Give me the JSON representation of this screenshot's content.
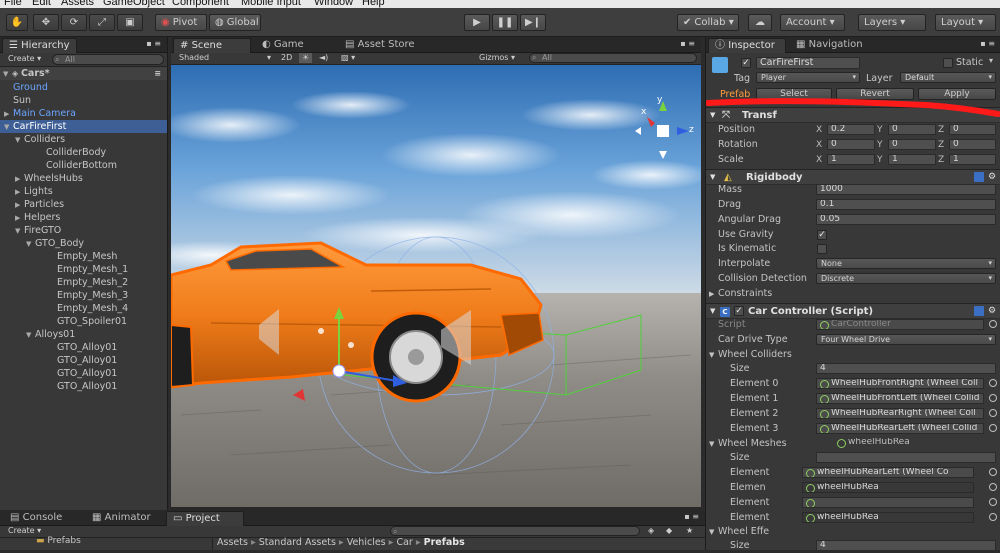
{
  "menu": [
    "File",
    "Edit",
    "Assets",
    "GameObject",
    "Component",
    "Mobile Input",
    "Window",
    "Help"
  ],
  "toolbar": {
    "pivot": "Pivot",
    "global": "Global",
    "collab": "Collab",
    "account": "Account",
    "layers": "Layers",
    "layout": "Layout"
  },
  "hierarchy": {
    "tab": "Hierarchy",
    "create": "Create",
    "search_placeholder": "All",
    "scene_name": "Cars*",
    "items": [
      {
        "label": "Ground",
        "indent": 1,
        "style": "blue",
        "arrow": ""
      },
      {
        "label": "Sun",
        "indent": 1,
        "style": "",
        "arrow": ""
      },
      {
        "label": "Main Camera",
        "indent": 1,
        "style": "blue",
        "arrow": "▶"
      },
      {
        "label": "CarFireFirst",
        "indent": 1,
        "style": "sel",
        "arrow": "▼"
      },
      {
        "label": "Colliders",
        "indent": 2,
        "style": "",
        "arrow": "▼"
      },
      {
        "label": "ColliderBody",
        "indent": 4,
        "style": "",
        "arrow": ""
      },
      {
        "label": "ColliderBottom",
        "indent": 4,
        "style": "",
        "arrow": ""
      },
      {
        "label": "WheelsHubs",
        "indent": 2,
        "style": "",
        "arrow": "▶"
      },
      {
        "label": "Lights",
        "indent": 2,
        "style": "",
        "arrow": "▶"
      },
      {
        "label": "Particles",
        "indent": 2,
        "style": "",
        "arrow": "▶"
      },
      {
        "label": "Helpers",
        "indent": 2,
        "style": "",
        "arrow": "▶"
      },
      {
        "label": "FireGTO",
        "indent": 2,
        "style": "",
        "arrow": "▼"
      },
      {
        "label": "GTO_Body",
        "indent": 3,
        "style": "",
        "arrow": "▼"
      },
      {
        "label": "Empty_Mesh",
        "indent": 5,
        "style": "",
        "arrow": ""
      },
      {
        "label": "Empty_Mesh_1",
        "indent": 5,
        "style": "",
        "arrow": ""
      },
      {
        "label": "Empty_Mesh_2",
        "indent": 5,
        "style": "",
        "arrow": ""
      },
      {
        "label": "Empty_Mesh_3",
        "indent": 5,
        "style": "",
        "arrow": ""
      },
      {
        "label": "Empty_Mesh_4",
        "indent": 5,
        "style": "",
        "arrow": ""
      },
      {
        "label": "GTO_Spoiler01",
        "indent": 5,
        "style": "",
        "arrow": ""
      },
      {
        "label": "Alloys01",
        "indent": 3,
        "style": "",
        "arrow": "▼"
      },
      {
        "label": "GTO_Alloy01",
        "indent": 5,
        "style": "",
        "arrow": ""
      },
      {
        "label": "GTO_Alloy01",
        "indent": 5,
        "style": "",
        "arrow": ""
      },
      {
        "label": "GTO_Alloy01",
        "indent": 5,
        "style": "",
        "arrow": ""
      },
      {
        "label": "GTO_Alloy01",
        "indent": 5,
        "style": "",
        "arrow": ""
      }
    ]
  },
  "scene": {
    "tabs": [
      "Scene",
      "Game",
      "Asset Store"
    ],
    "shaded": "Shaded",
    "mode_2d": "2D",
    "gizmos": "Gizmos",
    "search_placeholder": "All",
    "axis_y": "y",
    "axis_x": "x",
    "axis_z": "z"
  },
  "inspector": {
    "tabs": [
      "Inspector",
      "Navigation"
    ],
    "object_name": "CarFireFirst",
    "static_label": "Static",
    "tag_label": "Tag",
    "tag_value": "Player",
    "layer_label": "Layer",
    "layer_value": "Default",
    "prefab_label": "Prefab",
    "prefab_select": "Select",
    "prefab_revert": "Revert",
    "prefab_apply": "Apply",
    "transform": {
      "title": "Transf",
      "rows": [
        {
          "label": "Position",
          "x": "0.2",
          "y": "0",
          "z": "0"
        },
        {
          "label": "Rotation",
          "x": "0",
          "y": "0",
          "z": "0"
        },
        {
          "label": "Scale",
          "x": "1",
          "y": "1",
          "z": "1"
        }
      ]
    },
    "rigidbody": {
      "title": "Rigidbody",
      "mass_label": "Mass",
      "mass": "1000",
      "drag_label": "Drag",
      "drag": "0.1",
      "angular_drag_label": "Angular Drag",
      "angular_drag": "0.05",
      "use_gravity_label": "Use Gravity",
      "is_kinematic_label": "Is Kinematic",
      "interpolate_label": "Interpolate",
      "interpolate": "None",
      "collision_label": "Collision Detection",
      "collision": "Discrete",
      "constraints_label": "Constraints"
    },
    "car_controller": {
      "title": "Car Controller (Script)",
      "script_label": "Script",
      "script": "CarController",
      "drive_label": "Car Drive Type",
      "drive": "Four Wheel Drive",
      "colliders_label": "Wheel Colliders",
      "size_label": "Size",
      "size": "4",
      "colliders": [
        {
          "label": "Element 0",
          "value": "WheelHubFrontRight (Wheel Coll"
        },
        {
          "label": "Element 1",
          "value": "WheelHubFrontLeft (Wheel Collid"
        },
        {
          "label": "Element 2",
          "value": "WheelHubRearRight (Wheel Coll"
        },
        {
          "label": "Element 3",
          "value": "WheelHubRearLeft (Wheel Collid"
        }
      ],
      "meshes_label": "Wheel Meshes",
      "mesh_size_label": "Size",
      "meshes": [
        {
          "label": "Element",
          "value": "wheelHubRearLeft (Wheel Co"
        },
        {
          "label": "Elemen",
          "value": "wheelHubRea"
        },
        {
          "label": "Element",
          "value": ""
        },
        {
          "label": "Element",
          "value": "wheelHubRea"
        }
      ],
      "mesh_size_field": "wheelHubRea",
      "effects_label": "Wheel Effe",
      "effects_size_label": "Size",
      "effects_size": "4"
    }
  },
  "bottom": {
    "tabs": [
      "Console",
      "Animator",
      "Project"
    ],
    "create": "Create",
    "folder": "Prefabs",
    "breadcrumb": [
      "Assets",
      "Standard Assets",
      "Vehicles",
      "Car",
      "Prefabs"
    ]
  }
}
